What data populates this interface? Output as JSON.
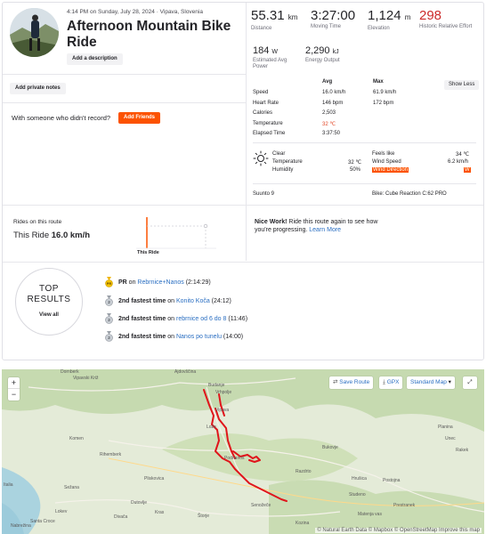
{
  "activity": {
    "meta": "4:14 PM on Sunday, July 28, 2024 · Vipava, Slovenia",
    "title": "Afternoon Mountain Bike Ride",
    "add_description": "Add a description",
    "add_private_notes": "Add private notes",
    "friends_text": "With someone who didn't record?",
    "add_friends": "Add Friends"
  },
  "stats": {
    "distance": {
      "value": "55.31",
      "unit": "km",
      "label": "Distance"
    },
    "moving_time": {
      "value": "3:27:00",
      "label": "Moving Time"
    },
    "elevation": {
      "value": "1,124",
      "unit": "m",
      "label": "Elevation"
    },
    "relative_effort": {
      "value": "298",
      "label": "Historic Relative Effort"
    },
    "weighted_power": {
      "value": "184",
      "unit": "W",
      "label": "Estimated Avg Power"
    },
    "energy": {
      "value": "2,290",
      "unit": "kJ",
      "label": "Energy Output"
    }
  },
  "table": {
    "head_avg": "Avg",
    "head_max": "Max",
    "show_less": "Show Less",
    "rows": [
      {
        "label": "Speed",
        "avg": "16.0 km/h",
        "max": "61.9 km/h"
      },
      {
        "label": "Heart Rate",
        "avg": "146 bpm",
        "max": "172 bpm"
      },
      {
        "label": "Calories",
        "avg": "2,503",
        "max": ""
      },
      {
        "label": "Temperature",
        "avg": "32 ℃",
        "max": ""
      },
      {
        "label": "Elapsed Time",
        "avg": "3:37:50",
        "max": ""
      }
    ]
  },
  "weather": {
    "condition": "Clear",
    "temperature_label": "Temperature",
    "temperature": "32 ℃",
    "humidity_label": "Humidity",
    "humidity": "50%",
    "feels_like_label": "Feels like",
    "feels_like": "34 ℃",
    "wind_speed_label": "Wind Speed",
    "wind_speed": "6.2 km/h",
    "wind_direction_label": "Wind Direction",
    "wind_direction": "W"
  },
  "device": {
    "name": "Suunto 9",
    "bike": "Bike: Cube Reaction C:62 PRO"
  },
  "rides": {
    "label": "Rides on this route",
    "this_ride_label": "This Ride",
    "this_ride_value": "16.0 km/h",
    "chart_label": "This Ride",
    "nice_work": "Nice Work!",
    "message": "Ride this route again to see how you're progressing.",
    "learn_more": "Learn More"
  },
  "results": {
    "badge_line1": "TOP",
    "badge_line2": "RESULTS",
    "view_all": "View all",
    "items": [
      {
        "prefix": "PR",
        "mid": " on ",
        "segment": "Rebrnice+Nanos",
        "time": " (2:14:29)"
      },
      {
        "prefix": "2nd fastest time",
        "mid": " on ",
        "segment": "Konito Koča",
        "time": " (24:12)"
      },
      {
        "prefix": "2nd fastest time",
        "mid": " on ",
        "segment": "rebrnice od 6 do 8",
        "time": " (11:46)"
      },
      {
        "prefix": "2nd fastest time",
        "mid": " on ",
        "segment": "Nanos po tunelu",
        "time": " (14:00)"
      }
    ]
  },
  "map": {
    "save_route": "Save Route",
    "gpx": "GPX",
    "map_style": "Standard Map",
    "zoom_in": "+",
    "zoom_out": "−",
    "attribution": "© Natural Earth Data © Mapbox © OpenStreetMap Improve this map",
    "towns": [
      "Dornberk",
      "Ajdovščina",
      "Vipavski Križ",
      "Budanje",
      "Vrhpolje",
      "Vipava",
      "Lože",
      "Podnanos",
      "Razdrto",
      "Senožeče",
      "Komen",
      "Rihemberk",
      "Pliskovica",
      "Sežana",
      "Lokev",
      "Divača",
      "Postojna",
      "Hrušica",
      "Studeno",
      "Bukovje",
      "Planina",
      "Unec",
      "Rakek",
      "Prestranek",
      "Štorje",
      "Dutovlje",
      "Kras",
      "Italia",
      "Santa Croce",
      "Kozina",
      "Matenja vas",
      "Nabrežina"
    ]
  },
  "colors": {
    "accent": "#fc5200",
    "link": "#2b6fc2",
    "effort": "#cc2a2a",
    "route": "#e0151b"
  }
}
